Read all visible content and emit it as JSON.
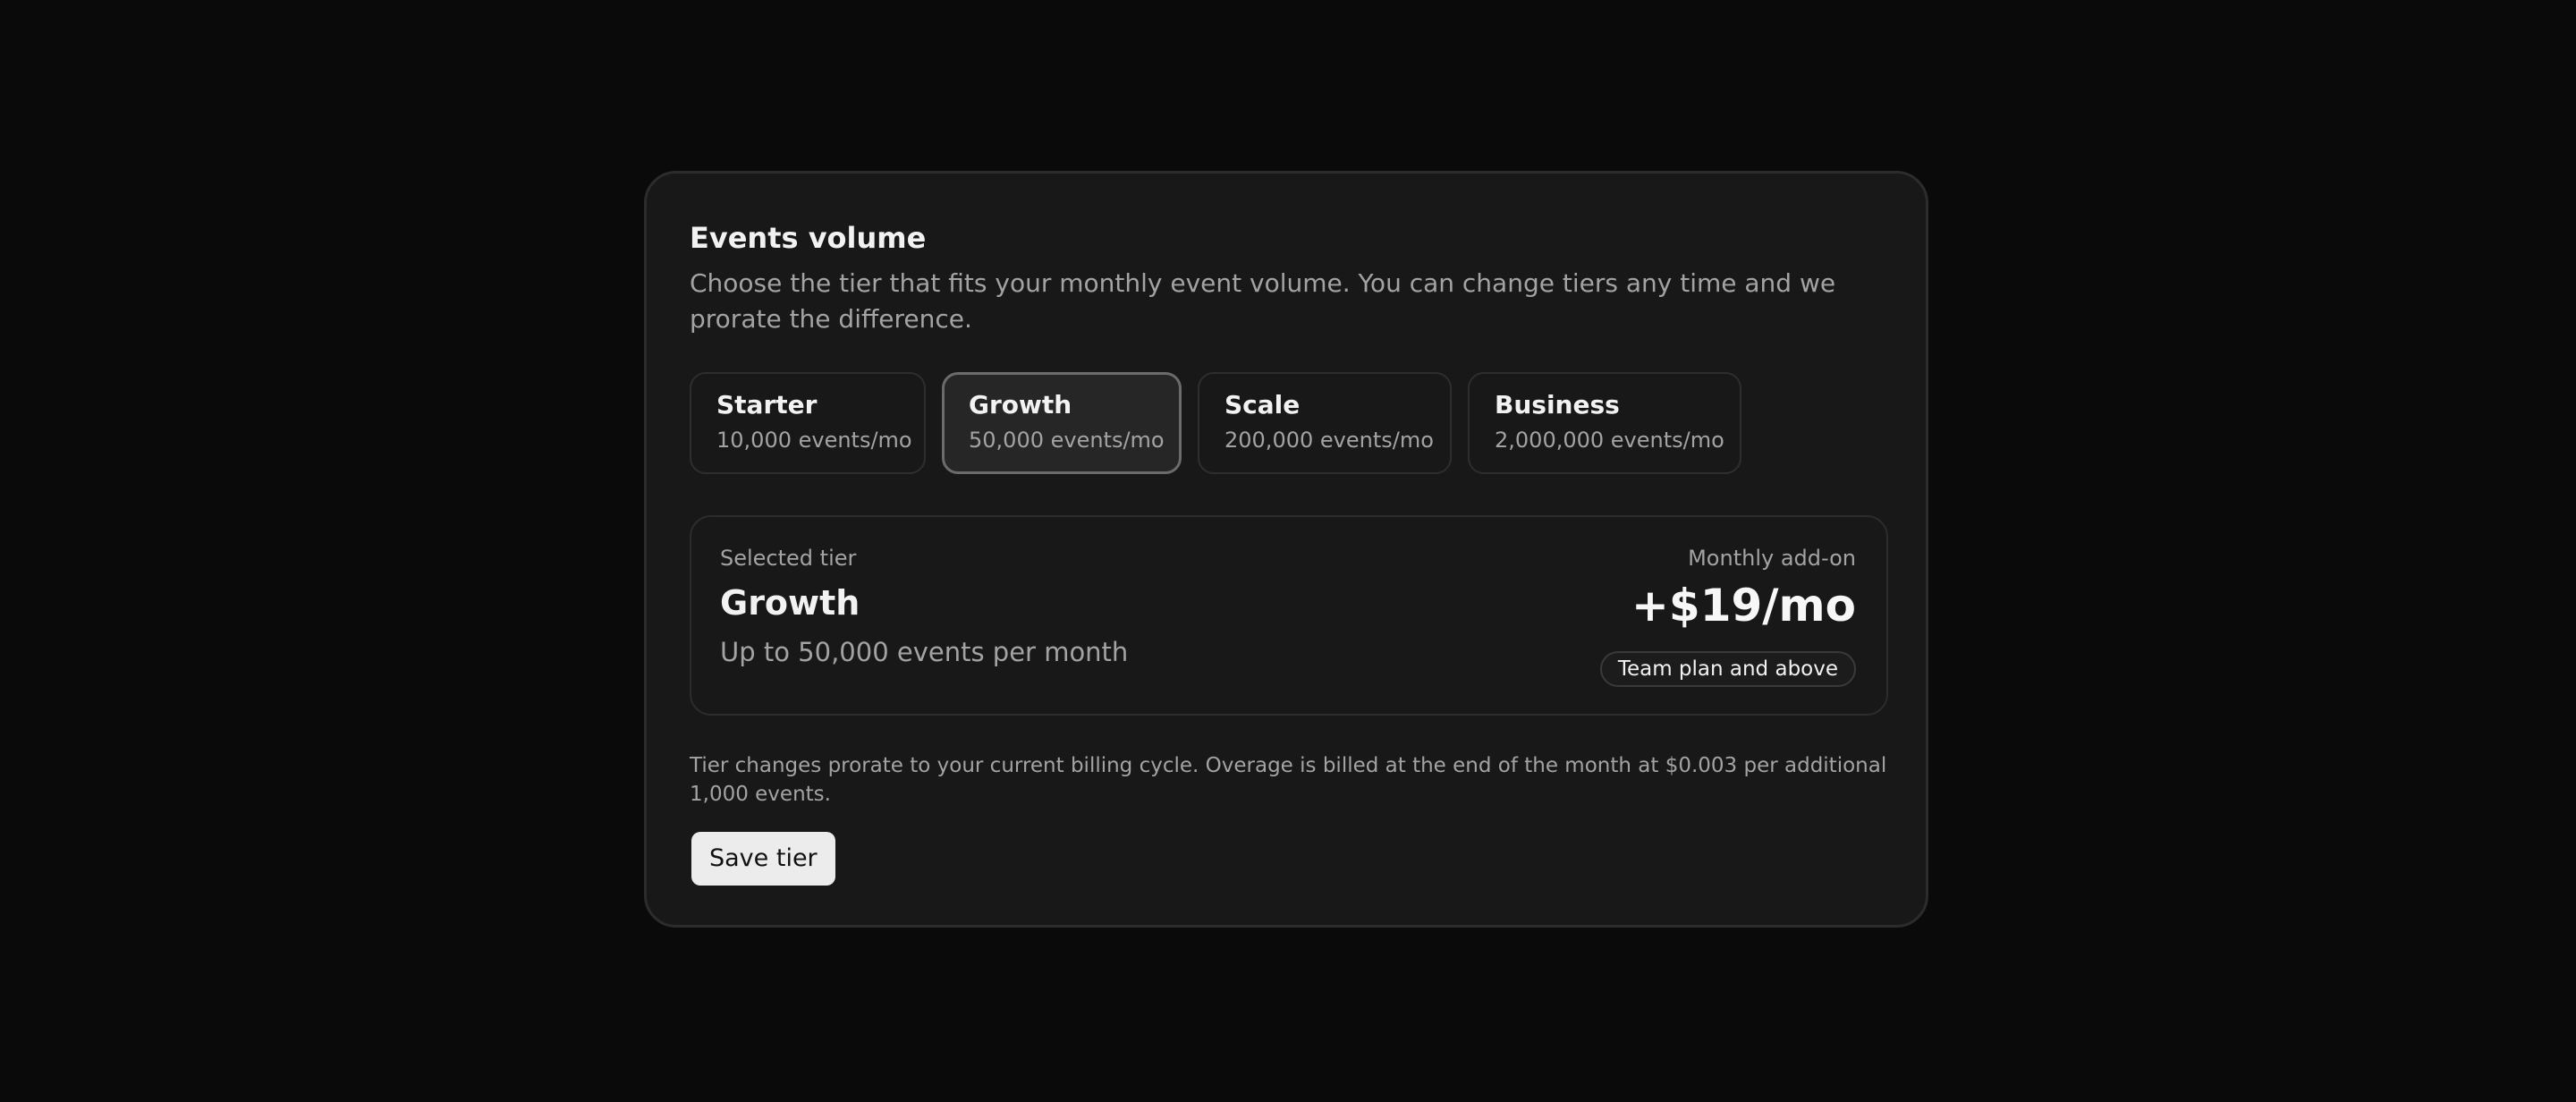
{
  "panel": {
    "title": "Events volume",
    "description": "Choose the tier that fits your monthly event volume. You can change tiers any time and we prorate the difference."
  },
  "tiers": [
    {
      "name": "Starter",
      "events": "10,000 events/mo",
      "selected": false
    },
    {
      "name": "Growth",
      "events": "50,000 events/mo",
      "selected": true
    },
    {
      "name": "Scale",
      "events": "200,000 events/mo",
      "selected": false
    },
    {
      "name": "Business",
      "events": "2,000,000 events/mo",
      "selected": false
    }
  ],
  "summary": {
    "label": "Selected tier",
    "name": "Growth",
    "description": "Up to 50,000 events per month",
    "addon_label": "Monthly add-on",
    "addon_price": "+$19/mo",
    "badge": "Team plan and above"
  },
  "footer": {
    "note": "Tier changes prorate to your current billing cycle. Overage is billed at the end of the month at $0.003 per additional 1,000 events.",
    "save_label": "Save tier"
  },
  "colors": {
    "page_background": "#0a0a0a",
    "card_background": "#181818",
    "selected_tier_background": "#262626",
    "selected_tier_border": "#6b6b6b",
    "button_background": "#ececec",
    "text_primary": "#f2f2f2",
    "text_secondary": "#a3a3a3"
  }
}
